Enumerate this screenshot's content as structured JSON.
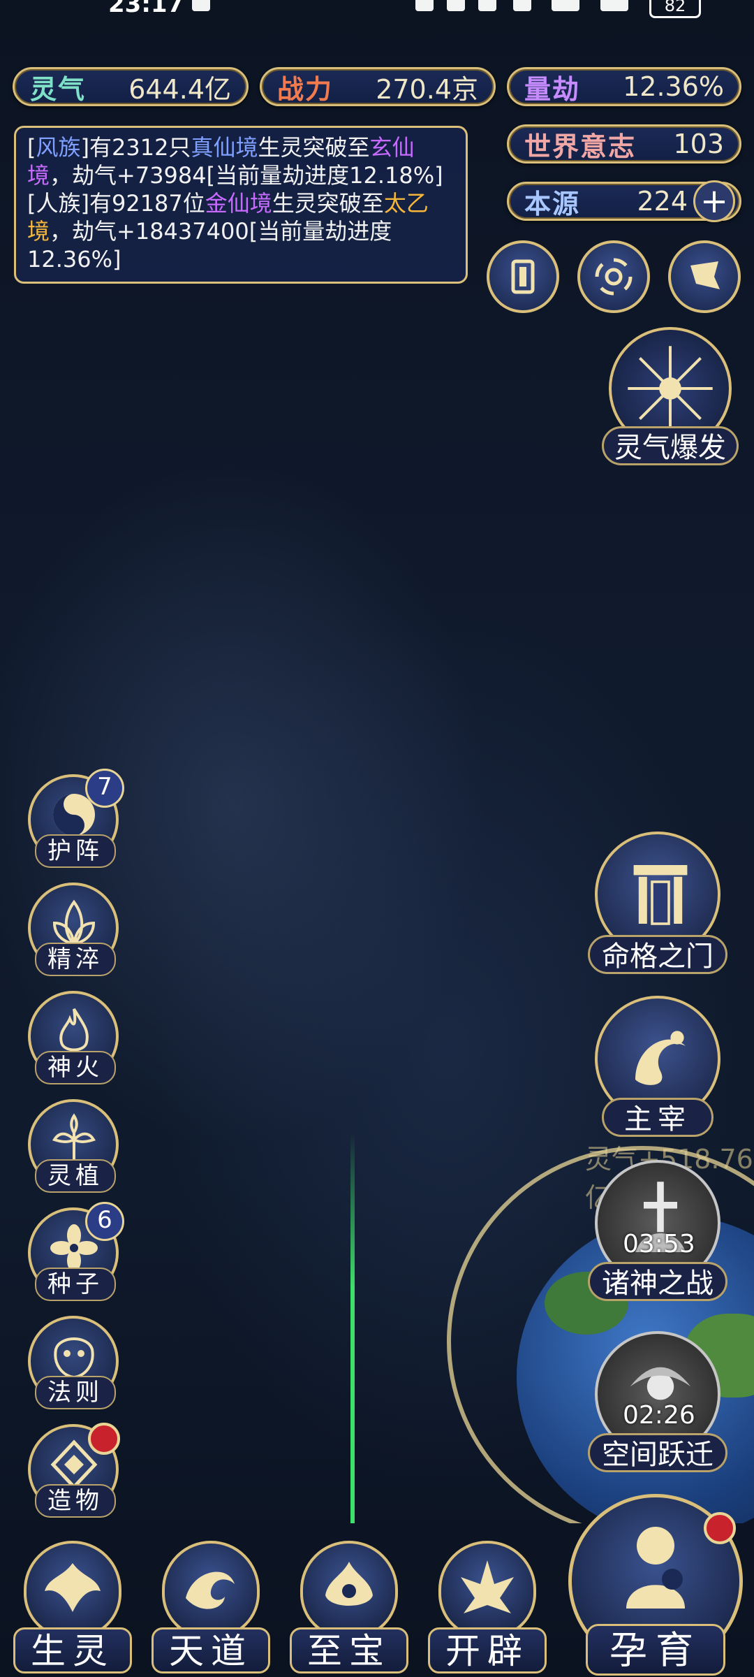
{
  "status": {
    "time": "23:17",
    "battery": "82"
  },
  "resources": {
    "lingqi": {
      "label": "灵气",
      "value": "644.4亿"
    },
    "zhanli": {
      "label": "战力",
      "value": "270.4京"
    },
    "liangjie": {
      "label": "量劫",
      "value": "12.36%"
    },
    "shijie": {
      "label": "世界意志",
      "value": "103"
    },
    "benyuan": {
      "label": "本源",
      "value": "224"
    }
  },
  "log": {
    "line1": {
      "a": "[",
      "b": "风族",
      "c": "]有2312只",
      "d": "真仙境",
      "e": "生灵突破至",
      "f": "玄仙境",
      "g": "，劫气+73984[当前量劫进度12.18%]"
    },
    "line2": {
      "a": "[人族]有92187位",
      "b": "金仙境",
      "c": "生灵突破至",
      "d": "太乙境",
      "e": "，劫气+18437400[当前量劫进度12.36%]"
    }
  },
  "burst": {
    "label": "灵气爆发"
  },
  "side": [
    {
      "label": "护阵",
      "badge": "7"
    },
    {
      "label": "精淬"
    },
    {
      "label": "神火"
    },
    {
      "label": "灵植"
    },
    {
      "label": "种子",
      "badge": "6"
    },
    {
      "label": "法则"
    },
    {
      "label": "造物"
    }
  ],
  "right": {
    "minggemen": "命格之门",
    "zhuzai": "主宰",
    "zhushen": "诸神之战",
    "zhushen_timer": "03:53",
    "kongjian": "空间跃迁",
    "kongjian_timer": "02:26",
    "float_text": "灵气+518.76亿"
  },
  "bottom": {
    "b1": "生灵",
    "b2": "天道",
    "b3": "至宝",
    "b4": "开辟",
    "b5": "孕育"
  },
  "colors": {
    "gold": "#d9bf7a",
    "badge_red": "#c8232c",
    "beam_green": "#3fe06a"
  }
}
